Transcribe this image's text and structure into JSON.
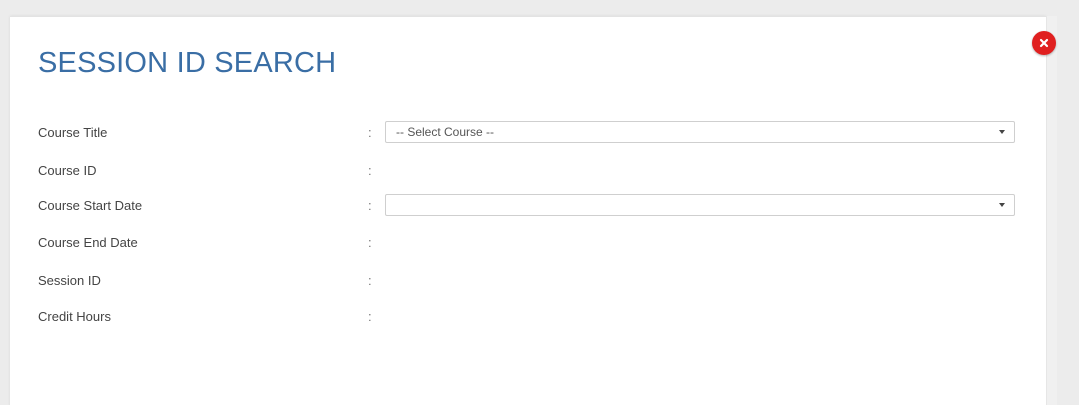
{
  "modal": {
    "title": "SESSION ID SEARCH",
    "close_icon": "close-icon",
    "colors": {
      "title": "#3a6ea5",
      "close_button": "#e02020"
    }
  },
  "form": {
    "separator": ":",
    "fields": [
      {
        "label": "Course Title",
        "type": "select",
        "value": "-- Select Course --"
      },
      {
        "label": "Course ID",
        "type": "text",
        "value": ""
      },
      {
        "label": "Course Start Date",
        "type": "select",
        "value": ""
      },
      {
        "label": "Course End Date",
        "type": "text",
        "value": ""
      },
      {
        "label": "Session ID",
        "type": "text",
        "value": ""
      },
      {
        "label": "Credit Hours",
        "type": "text",
        "value": ""
      }
    ]
  }
}
